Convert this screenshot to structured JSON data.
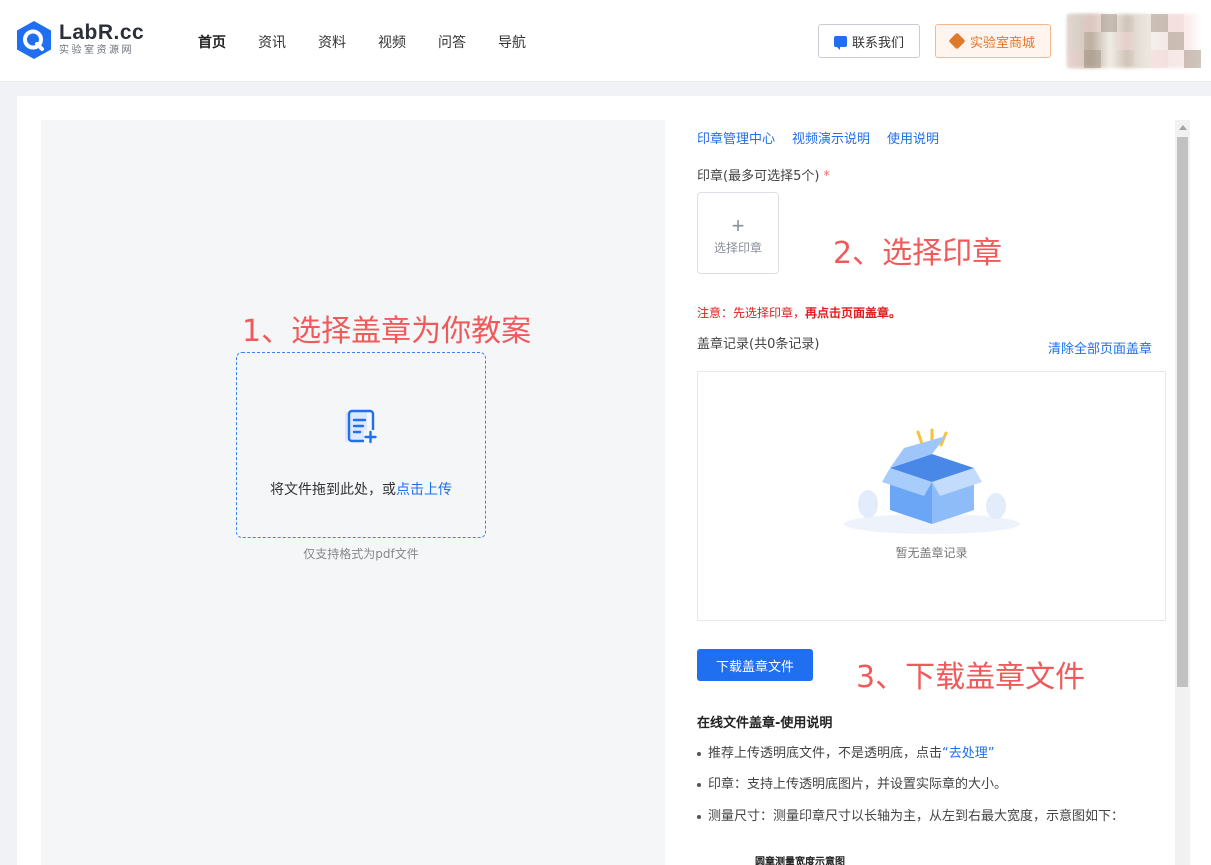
{
  "header": {
    "logo_title": "LabR.cc",
    "logo_subtitle": "实验室资源网",
    "nav": [
      "首页",
      "资讯",
      "资料",
      "视频",
      "问答",
      "导航"
    ],
    "active_nav": "首页",
    "contact_label": "联系我们",
    "shop_label": "实验室商城"
  },
  "preview": {
    "step1": "1、选择盖章为你教案",
    "drop_text": "将文件拖到此处，或",
    "drop_link": "点击上传",
    "drop_hint": "仅支持格式为pdf文件"
  },
  "panel": {
    "links": [
      "印章管理中心",
      "视频演示说明",
      "使用说明"
    ],
    "seal_label": "印章(最多可选择5个)",
    "required_mark": "*",
    "seal_plus": "+",
    "seal_select": "选择印章",
    "step2": "2、选择印章",
    "notice_prefix": "注意：先选择印章，",
    "notice_bold": "再点击页面盖章。",
    "records_label": "盖章记录(共0条记录)",
    "clear_link": "清除全部页面盖章",
    "empty_text": "暂无盖章记录",
    "download_label": "下载盖章文件",
    "step3": "3、下载盖章文件",
    "guide_title": "在线文件盖章-使用说明",
    "guide1_text": "推荐上传透明底文件，不是透明底，点击",
    "guide1_link": "“去处理”",
    "guide2": "印章：支持上传透明底图片，并设置实际章的大小。",
    "guide3": "测量尺寸：测量印章尺寸以长轴为主，从左到右最大宽度，示意图如下：",
    "diagram_title": "圆章测量宽度示意图"
  },
  "colors": {
    "primary": "#1f6ff0",
    "annotation": "#f15a5a",
    "shop": "#e0782c",
    "notice": "#e11d1d"
  }
}
